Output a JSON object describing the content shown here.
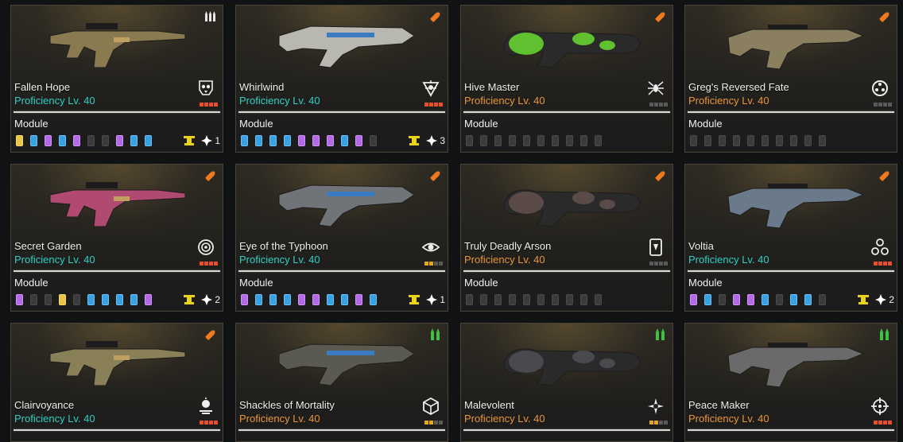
{
  "colors": {
    "teal_proficiency": "#2ed0c4",
    "orange_proficiency": "#e9953a",
    "slot_yellow": "#e9c64a",
    "slot_blue": "#3aa0e6",
    "slot_purple": "#b46ae8",
    "slot_empty": "#3b3b3b",
    "star_red": "#e8502a",
    "star_gold": "#e4a820",
    "star_gray": "#5a5a5a"
  },
  "cards": [
    {
      "name": "Fallen Hope",
      "proficiency": "Proficiency Lv. 40",
      "prof_color": "teal",
      "ammo_icon": "general-rounds-icon",
      "type_icon": "skull-emblem-icon",
      "stars": "red",
      "module_label": "Module",
      "slots": [
        "yellow",
        "blue",
        "purple",
        "blue",
        "purple",
        "empty",
        "empty",
        "purple",
        "blue",
        "blue"
      ],
      "catalyst": true,
      "crystal_count": "1",
      "weapon_color": "#8a7a50"
    },
    {
      "name": "Whirlwind",
      "proficiency": "Proficiency Lv. 40",
      "prof_color": "teal",
      "ammo_icon": "special-rounds-icon",
      "type_icon": "burst-emblem-icon",
      "stars": "red",
      "module_label": "Module",
      "slots": [
        "blue",
        "blue",
        "blue",
        "blue",
        "purple",
        "purple",
        "purple",
        "blue",
        "purple",
        "empty"
      ],
      "catalyst": true,
      "crystal_count": "3",
      "weapon_color": "#b8b8b0"
    },
    {
      "name": "Hive Master",
      "proficiency": "Proficiency Lv. 40",
      "prof_color": "orange",
      "ammo_icon": "special-rounds-icon",
      "type_icon": "spider-emblem-icon",
      "stars": "gray",
      "module_label": "Module",
      "slots": [
        "empty",
        "empty",
        "empty",
        "empty",
        "empty",
        "empty",
        "empty",
        "empty",
        "empty",
        "empty"
      ],
      "catalyst": false,
      "crystal_count": "",
      "weapon_color": "#5fc030"
    },
    {
      "name": "Greg's Reversed Fate",
      "proficiency": "Proficiency Lv. 40",
      "prof_color": "orange",
      "ammo_icon": "special-rounds-icon",
      "type_icon": "gear-emblem-icon",
      "stars": "gray",
      "module_label": "Module",
      "slots": [
        "empty",
        "empty",
        "empty",
        "empty",
        "empty",
        "empty",
        "empty",
        "empty",
        "empty",
        "empty"
      ],
      "catalyst": false,
      "crystal_count": "",
      "weapon_color": "#8a8060"
    },
    {
      "name": "Secret Garden",
      "proficiency": "Proficiency Lv. 40",
      "prof_color": "teal",
      "ammo_icon": "special-rounds-icon",
      "type_icon": "rose-emblem-icon",
      "stars": "red",
      "module_label": "Module",
      "slots": [
        "purple",
        "empty",
        "empty",
        "yellow",
        "empty",
        "blue",
        "blue",
        "blue",
        "blue",
        "purple"
      ],
      "catalyst": true,
      "crystal_count": "2",
      "weapon_color": "#b04a70"
    },
    {
      "name": "Eye of the Typhoon",
      "proficiency": "Proficiency Lv. 40",
      "prof_color": "teal",
      "ammo_icon": "special-rounds-icon",
      "type_icon": "eye-emblem-icon",
      "stars": "gold",
      "module_label": "Module",
      "slots": [
        "purple",
        "blue",
        "blue",
        "blue",
        "purple",
        "purple",
        "blue",
        "blue",
        "purple",
        "blue"
      ],
      "catalyst": true,
      "crystal_count": "1",
      "weapon_color": "#707478"
    },
    {
      "name": "Truly Deadly Arson",
      "proficiency": "Proficiency Lv. 40",
      "prof_color": "orange",
      "ammo_icon": "special-rounds-icon",
      "type_icon": "card-emblem-icon",
      "stars": "gray",
      "module_label": "Module",
      "slots": [
        "empty",
        "empty",
        "empty",
        "empty",
        "empty",
        "empty",
        "empty",
        "empty",
        "empty",
        "empty"
      ],
      "catalyst": false,
      "crystal_count": "",
      "weapon_color": "#5a4a48"
    },
    {
      "name": "Voltia",
      "proficiency": "Proficiency Lv. 40",
      "prof_color": "teal",
      "ammo_icon": "special-rounds-icon",
      "type_icon": "triad-emblem-icon",
      "stars": "red",
      "module_label": "Module",
      "slots": [
        "purple",
        "blue",
        "empty",
        "purple",
        "purple",
        "blue",
        "empty",
        "blue",
        "blue",
        "empty"
      ],
      "catalyst": true,
      "crystal_count": "2",
      "weapon_color": "#6a7a8a"
    },
    {
      "name": "Clairvoyance",
      "proficiency": "Proficiency Lv. 40",
      "prof_color": "teal",
      "ammo_icon": "special-rounds-icon",
      "type_icon": "lamp-emblem-icon",
      "stars": "red",
      "weapon_color": "#8a8058"
    },
    {
      "name": "Shackles of Mortality",
      "proficiency": "Proficiency Lv. 40",
      "prof_color": "orange",
      "ammo_icon": "impact-rounds-icon",
      "type_icon": "cube-emblem-icon",
      "stars": "gold",
      "weapon_color": "#5a5a50"
    },
    {
      "name": "Malevolent",
      "proficiency": "Proficiency Lv. 40",
      "prof_color": "orange",
      "ammo_icon": "impact-rounds-icon",
      "type_icon": "spiral-emblem-icon",
      "stars": "gold",
      "weapon_color": "#4a4a4e"
    },
    {
      "name": "Peace Maker",
      "proficiency": "Proficiency Lv. 40",
      "prof_color": "orange",
      "ammo_icon": "impact-rounds-icon",
      "type_icon": "crosshair-emblem-icon",
      "stars": "red",
      "weapon_color": "#6a6a6a"
    }
  ]
}
